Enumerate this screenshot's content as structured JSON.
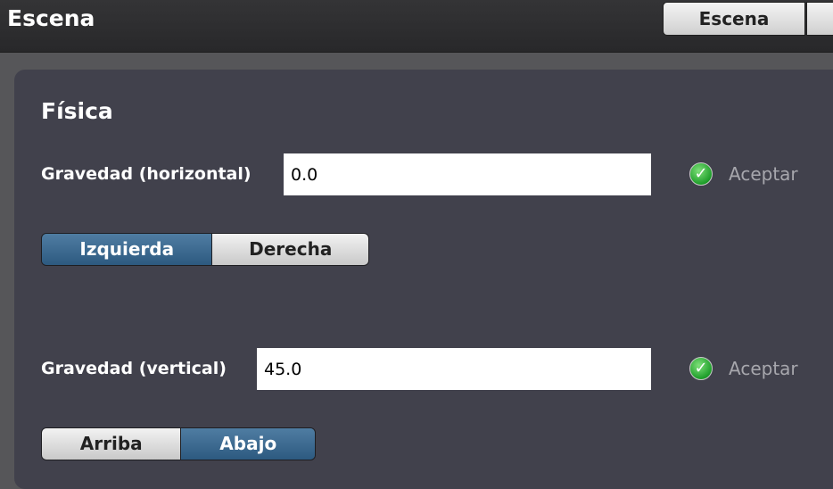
{
  "header": {
    "title": "Escena",
    "tab_label": "Escena"
  },
  "physics": {
    "section_title": "Física",
    "horizontal": {
      "label": "Gravedad (horizontal)",
      "value": "0.0",
      "accept_label": "Aceptar",
      "segments": [
        {
          "label": "Izquierda",
          "active": true
        },
        {
          "label": "Derecha",
          "active": false
        }
      ]
    },
    "vertical": {
      "label": "Gravedad (vertical)",
      "value": "45.0",
      "accept_label": "Aceptar",
      "segments": [
        {
          "label": "Arriba",
          "active": false
        },
        {
          "label": "Abajo",
          "active": true
        }
      ]
    }
  },
  "colors": {
    "panel_bg": "#41414c",
    "active_segment": "#2d5a80",
    "accept_text": "#a7a7ad"
  },
  "icons": {
    "accept": "check-circle-icon"
  }
}
